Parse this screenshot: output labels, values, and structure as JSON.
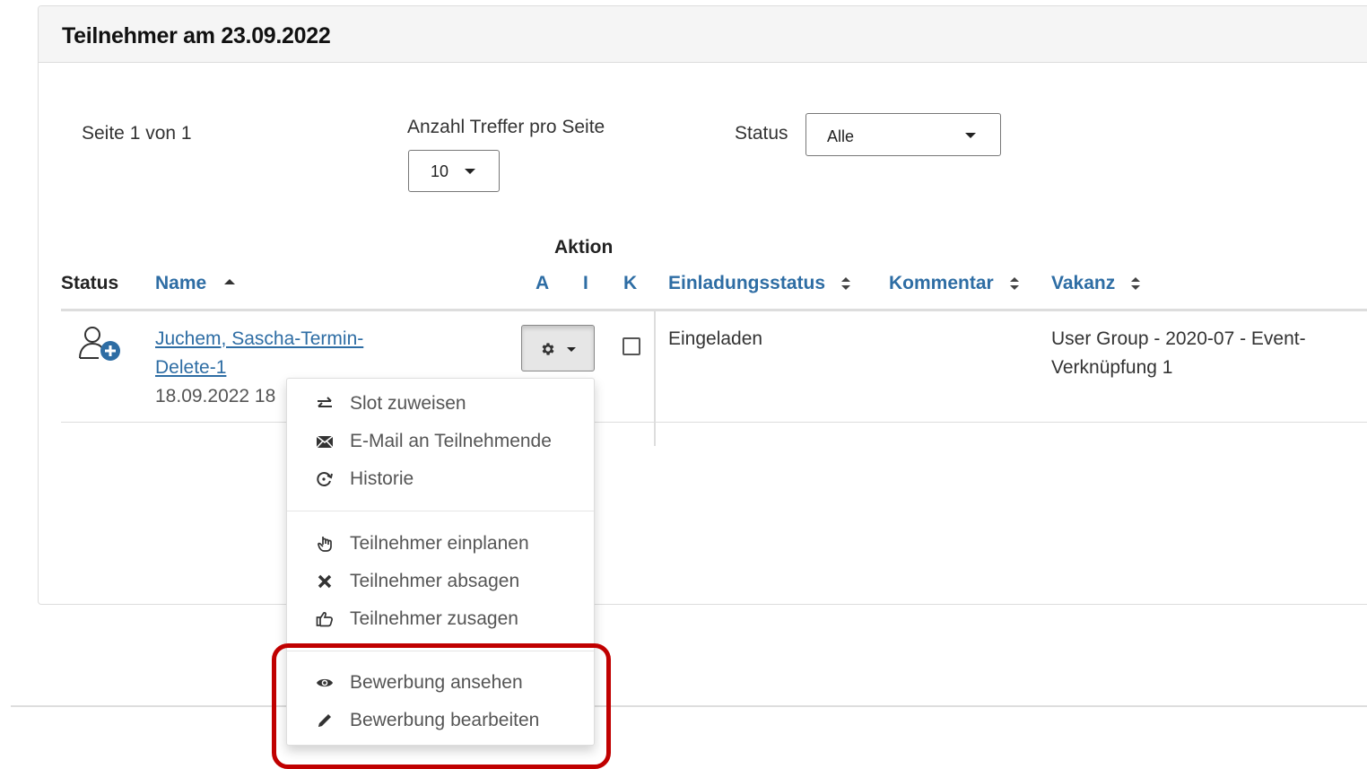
{
  "panel": {
    "title": "Teilnehmer am 23.09.2022"
  },
  "pager": {
    "page_info": "Seite 1 von 1",
    "per_page_label": "Anzahl Treffer pro Seite",
    "per_page_value": "10",
    "status_label": "Status",
    "status_value": "Alle"
  },
  "table": {
    "action_group": "Aktion",
    "headers": {
      "status": "Status",
      "name": "Name",
      "a": "A",
      "i": "I",
      "k": "K",
      "einladungsstatus": "Einladungsstatus",
      "kommentar": "Kommentar",
      "vakanz": "Vakanz"
    },
    "rows": [
      {
        "name_line1": "Juchem, Sascha-Termin-",
        "name_line2": "Delete-1",
        "date": "18.09.2022 18",
        "einladungsstatus": "Eingeladen",
        "vakanz_line1": "User Group - 2020-07 - Event-",
        "vakanz_line2": "Verknüpfung 1"
      }
    ]
  },
  "menu": {
    "group1": [
      {
        "label": "Slot zuweisen",
        "icon": "swap-icon"
      },
      {
        "label": "E-Mail an Teilnehmende",
        "icon": "envelope-icon"
      },
      {
        "label": "Historie",
        "icon": "history-icon"
      }
    ],
    "group2": [
      {
        "label": "Teilnehmer einplanen",
        "icon": "hand-pointer-icon"
      },
      {
        "label": "Teilnehmer absagen",
        "icon": "x-mark-icon"
      },
      {
        "label": "Teilnehmer zusagen",
        "icon": "thumbs-up-icon"
      }
    ],
    "group3": [
      {
        "label": "Bewerbung ansehen",
        "icon": "eye-icon"
      },
      {
        "label": "Bewerbung bearbeiten",
        "icon": "pencil-icon"
      }
    ]
  },
  "colors": {
    "link": "#2e6da4",
    "highlight": "#c00000"
  }
}
